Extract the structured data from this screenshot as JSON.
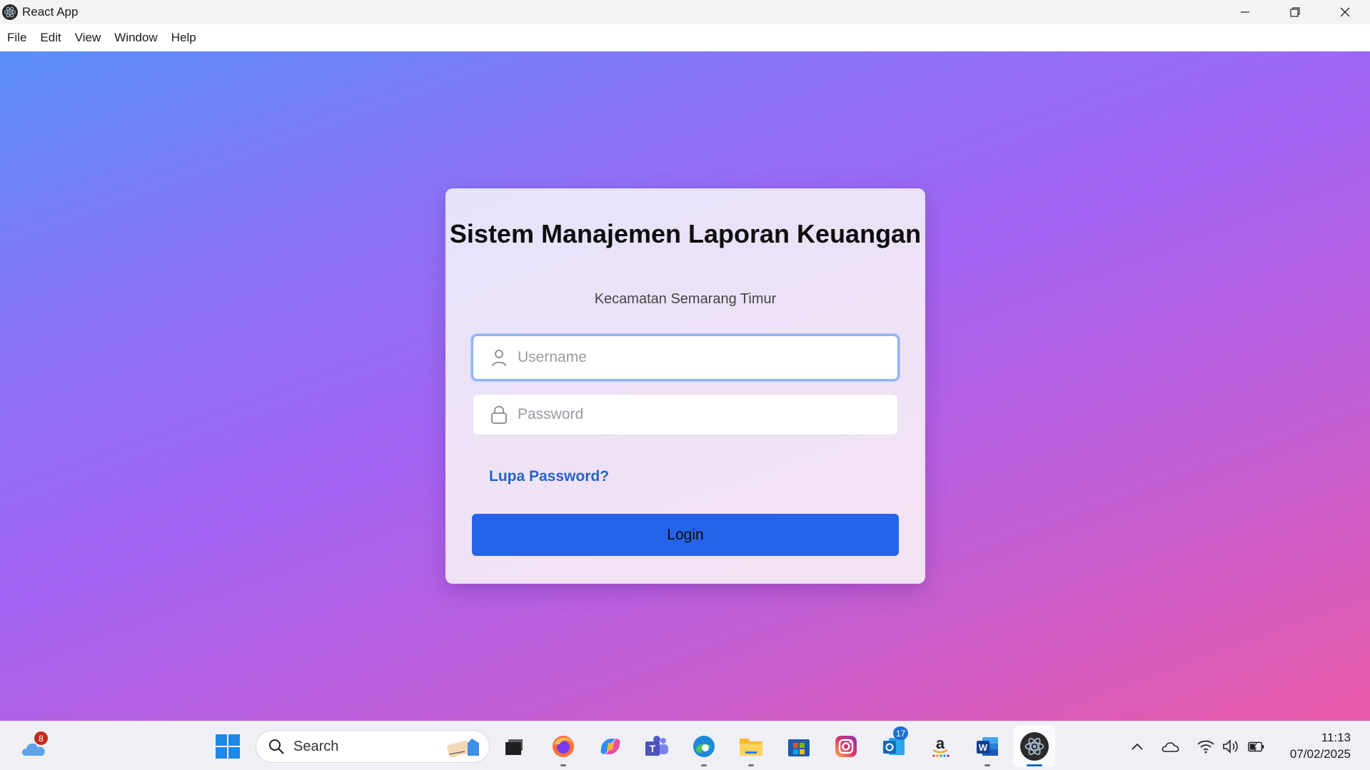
{
  "window": {
    "title": "React App",
    "minimize_icon": "minimize-icon",
    "restore_icon": "restore-icon",
    "close_icon": "close-icon"
  },
  "menu": [
    "File",
    "Edit",
    "View",
    "Window",
    "Help"
  ],
  "login": {
    "title": "Sistem Manajemen Laporan Keuangan",
    "subtitle": "Kecamatan Semarang Timur",
    "username_placeholder": "Username",
    "password_placeholder": "Password",
    "forgot_label": "Lupa Password?",
    "login_label": "Login"
  },
  "taskbar": {
    "weather_badge": "8",
    "search_label": "Search",
    "outlook_badge": "17",
    "apps": [
      "start",
      "search",
      "task-view",
      "firefox",
      "copilot",
      "teams",
      "edge",
      "file-explorer",
      "microsoft-store",
      "instagram",
      "outlook",
      "amazon",
      "word",
      "react-app"
    ],
    "tray": [
      "chevron-up",
      "onedrive",
      "wifi",
      "volume",
      "battery"
    ],
    "time": "11:13",
    "date": "07/02/2025"
  },
  "colors": {
    "accent": "#2563eb",
    "link": "#2563c9",
    "gradient_start": "#5b8ff8",
    "gradient_mid": "#a463f2",
    "gradient_end": "#e95aa8"
  }
}
